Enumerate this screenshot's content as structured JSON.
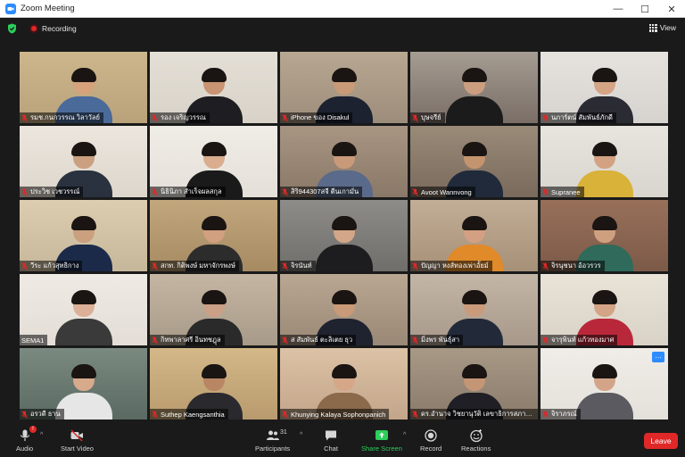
{
  "window": {
    "title": "Zoom Meeting",
    "controls": [
      "—",
      "☐",
      "✕"
    ]
  },
  "topbar": {
    "recording_label": "Recording",
    "view_label": "View"
  },
  "participants": [
    {
      "name": "รมช.กนกวรรณ วิลาวัลย์",
      "muted": true,
      "bg": "#b9a27a",
      "wall": "#cdb68c",
      "shirt": "#4a6a9a",
      "skin": "#d6a27c"
    },
    {
      "name": "รอง เจริญวรรณ",
      "muted": true,
      "bg": "#d8d2c8",
      "wall": "#e4dfd6",
      "shirt": "#1e1e22",
      "skin": "#c99472"
    },
    {
      "name": "iPhone ของ Disakul",
      "muted": true,
      "bg": "#9c8c7a",
      "wall": "#b8a892",
      "shirt": "#1c2230",
      "skin": "#c89a78"
    },
    {
      "name": "บุษจรีย์",
      "muted": true,
      "bg": "#7a6e66",
      "wall": "#a59c92",
      "shirt": "#1b1b1b",
      "skin": "#cc9e80"
    },
    {
      "name": "นภาร์ตน์ สัมพันธ์ภักดี",
      "muted": true,
      "bg": "#d6d3cf",
      "wall": "#e6e3df",
      "shirt": "#2b2b33",
      "skin": "#d4a485"
    },
    {
      "name": "ประวิช เวชวรรณ์",
      "muted": true,
      "bg": "#ddd6cc",
      "wall": "#ece6de",
      "shirt": "#2a3240",
      "skin": "#caa080"
    },
    {
      "name": "นิธินิภา สำเร็จผลสกุล",
      "muted": true,
      "bg": "#e4dfd8",
      "wall": "#f0ece6",
      "shirt": "#1a1a1a",
      "skin": "#d9ad8e"
    },
    {
      "name": "สิริ944307สจี ตีนเกามั่น",
      "muted": true,
      "bg": "#8a7868",
      "wall": "#a89582",
      "shirt": "#5a6a8a",
      "skin": "#c99a7a"
    },
    {
      "name": "Avoot Wannvong",
      "muted": true,
      "bg": "#7a6a5c",
      "wall": "#9a8a78",
      "shirt": "#202a3a",
      "skin": "#c4946e"
    },
    {
      "name": "Supranee",
      "muted": true,
      "bg": "#d8d4ce",
      "wall": "#e8e4de",
      "shirt": "#d9b23a",
      "skin": "#d2a283"
    },
    {
      "name": "วีระ แก้วสุทธิกาง",
      "muted": true,
      "bg": "#c7b79a",
      "wall": "#ddcdb0",
      "shirt": "#1c2a4a",
      "skin": "#caa07e"
    },
    {
      "name": "สกท. กิติพงษ์ มหาจักรพงษ์",
      "muted": true,
      "bg": "#a68a62",
      "wall": "#c2a67c",
      "shirt": "#2c2c2c",
      "skin": "#d0a080"
    },
    {
      "name": "จิรนันท์",
      "muted": true,
      "bg": "#6f6e6a",
      "wall": "#8e8c88",
      "shirt": "#1d1d1f",
      "skin": "#d3a688"
    },
    {
      "name": "ปัญญา หงส์ทองเพ่าอั้ยม์",
      "muted": true,
      "bg": "#a69078",
      "wall": "#c2ad96",
      "shirt": "#e08a2a",
      "skin": "#d4a083"
    },
    {
      "name": "จิรนุชนา อ้อวรวร",
      "muted": true,
      "bg": "#7c5a48",
      "wall": "#98705a",
      "shirt": "#2f6a5a",
      "skin": "#cfa080"
    },
    {
      "name": "SEMA1",
      "muted": false,
      "bg": "#e3ddd6",
      "wall": "#efeae4",
      "shirt": "#3a3a3a",
      "skin": "#dcb096"
    },
    {
      "name": "กิทพาลาศรี อินทชฎุล",
      "muted": true,
      "bg": "#a89a88",
      "wall": "#c4b6a2",
      "shirt": "#2a2a2a",
      "skin": "#caa086"
    },
    {
      "name": "ส สัมพันธ์ ตะลิเตย ธุว",
      "muted": true,
      "bg": "#9a8876",
      "wall": "#b9a792",
      "shirt": "#1f2330",
      "skin": "#c89a78"
    },
    {
      "name": "มิ่งพร พันธุ์สา",
      "muted": true,
      "bg": "#a7988a",
      "wall": "#c4b6a6",
      "shirt": "#222a3a",
      "skin": "#c99b7b"
    },
    {
      "name": "จารุพินท์ แก้วทองมาศ",
      "muted": true,
      "bg": "#d9d2c6",
      "wall": "#e9e3d8",
      "shirt": "#b9283a",
      "skin": "#d4a486"
    },
    {
      "name": "อรวดี ธาน",
      "muted": true,
      "bg": "#5a6a62",
      "wall": "#7a8a80",
      "shirt": "#e6e6e6",
      "skin": "#d8aa8c"
    },
    {
      "name": "Suthep Kaengsanthia",
      "muted": true,
      "bg": "#b89a6e",
      "wall": "#d4b888",
      "shirt": "#2a2a2e",
      "skin": "#b98664"
    },
    {
      "name": "Khunying Kalaya Sophonpanich",
      "muted": true,
      "bg": "#c3a58a",
      "wall": "#dcc2a6",
      "shirt": "#8a6a4a",
      "skin": "#d5a688"
    },
    {
      "name": "ดร.อำนาจ วิชยานุวัติ เลขาธิการสภาการ",
      "muted": true,
      "bg": "#8a7a6a",
      "wall": "#a89886",
      "shirt": "#1f1f25",
      "skin": "#c59676"
    },
    {
      "name": "จิราภรณ์",
      "muted": true,
      "bg": "#e4e0da",
      "wall": "#f0ede8",
      "shirt": "#5a5a60",
      "skin": "#d3a588"
    }
  ],
  "active_speaker_index": 22,
  "toolbar": {
    "audio_label": "Audio",
    "audio_badge": "!",
    "video_label": "Start Video",
    "participants_label": "Participants",
    "participants_count": "31",
    "chat_label": "Chat",
    "share_label": "Share Screen",
    "record_label": "Record",
    "reactions_label": "Reactions",
    "leave_label": "Leave"
  },
  "more_badge": "···",
  "colors": {
    "accent_blue": "#2d8cff",
    "recording_red": "#e02828",
    "share_green": "#2bcf5a",
    "active_outline": "#b8e04a",
    "leave_red": "#e02828"
  }
}
